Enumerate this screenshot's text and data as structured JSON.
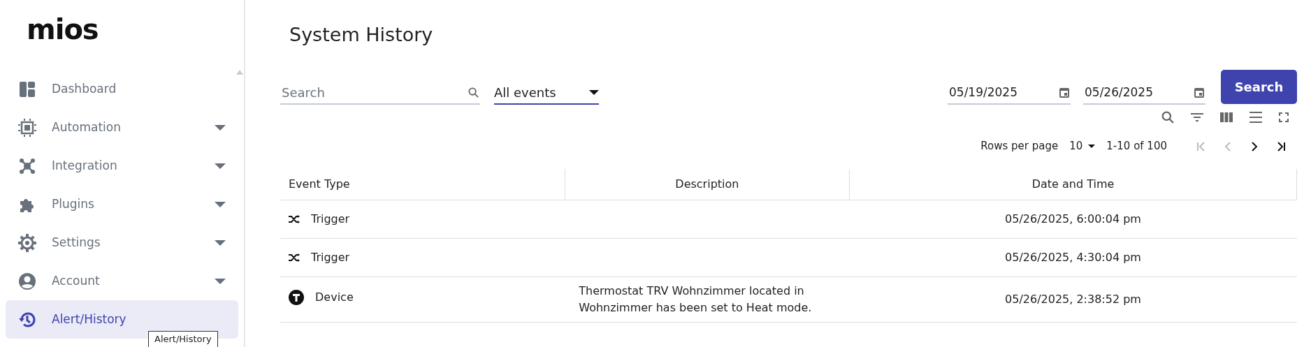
{
  "logo": {
    "text": "mios"
  },
  "sidebar": {
    "items": [
      {
        "label": "Dashboard",
        "expandable": false,
        "selected": false
      },
      {
        "label": "Automation",
        "expandable": true,
        "selected": false
      },
      {
        "label": "Integration",
        "expandable": true,
        "selected": false
      },
      {
        "label": "Plugins",
        "expandable": true,
        "selected": false
      },
      {
        "label": "Settings",
        "expandable": true,
        "selected": false
      },
      {
        "label": "Account",
        "expandable": true,
        "selected": false
      },
      {
        "label": "Alert/History",
        "expandable": false,
        "selected": true
      }
    ],
    "tooltip": "Alert/History"
  },
  "page": {
    "title": "System History"
  },
  "filters": {
    "search": {
      "placeholder": "Search"
    },
    "event_select": {
      "value": "All events"
    },
    "date_from": {
      "value": "05/19/2025"
    },
    "date_to": {
      "value": "05/26/2025"
    },
    "search_button": "Search"
  },
  "pagination": {
    "rows_per_page_label": "Rows per page",
    "rows_per_page": "10",
    "range": "1-10 of 100",
    "first_disabled": true,
    "prev_disabled": true,
    "next_disabled": false,
    "last_disabled": false
  },
  "table": {
    "columns": [
      "Event Type",
      "Description",
      "Date and Time"
    ],
    "rows": [
      {
        "kind": "trigger",
        "event_type": "Trigger",
        "date_time": "05/26/2025, 6:00:04 pm"
      },
      {
        "kind": "trigger",
        "event_type": "Trigger",
        "date_time": "05/26/2025, 4:30:04 pm"
      },
      {
        "kind": "device",
        "event_type": "Device",
        "description": "Thermostat TRV Wohnzimmer located in Wohnzimmer has been set to Heat mode.",
        "date_time": "05/26/2025, 2:38:52 pm"
      }
    ]
  }
}
